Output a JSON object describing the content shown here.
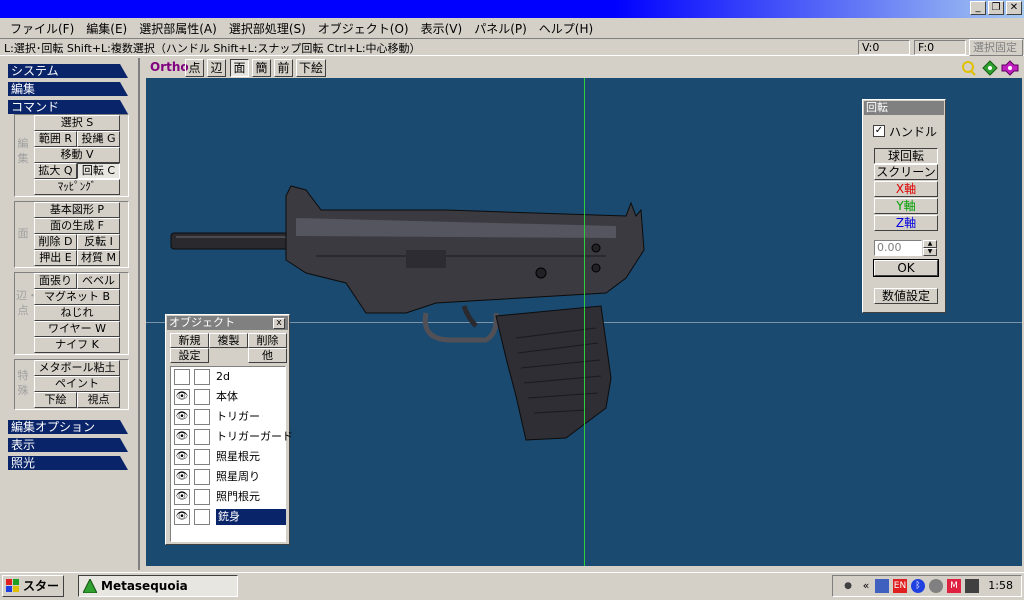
{
  "window": {
    "minimize_glyph": "_",
    "restore_glyph": "❐",
    "close_glyph": "✕"
  },
  "menu": [
    "ファイル(F)",
    "編集(E)",
    "選択部属性(A)",
    "選択部処理(S)",
    "オブジェクト(O)",
    "表示(V)",
    "パネル(P)",
    "ヘルプ(H)"
  ],
  "status": {
    "hint": "L:選択･回転  Shift+L:複数選択（ハンドル  Shift+L:スナップ回転  Ctrl+L:中心移動）",
    "v_value": "V:0",
    "f_value": "F:0",
    "lock_selection": "選択固定"
  },
  "left_panel": {
    "system": "システム",
    "edit": "編集",
    "command": "コマンド",
    "group_edit_label": "編集",
    "group_face_label": "面",
    "group_edge_label": "辺・点",
    "group_special_label": "特殊",
    "select": "選択 S",
    "range": "範囲 R",
    "lasso": "投縄 G",
    "move": "移動 V",
    "scale": "拡大 Q",
    "rotate": "回転 C",
    "mapping": "ﾏｯﾋﾟﾝｸﾞ",
    "basic_shape": "基本図形 P",
    "face_gen": "面の生成 F",
    "delete": "削除 D",
    "reverse": "反転 I",
    "extrude": "押出 E",
    "material": "材質 M",
    "face_stretch": "面張り",
    "bevel": "ベベル",
    "magnet": "マグネット B",
    "twist": "ねじれ",
    "wire": "ワイヤー W",
    "knife": "ナイフ K",
    "metaball": "メタボール粘土",
    "paint": "ペイント",
    "underlay": "下絵",
    "viewpoint": "視点",
    "edit_option": "編集オプション",
    "display": "表示",
    "lighting": "照光"
  },
  "view_toolbar": {
    "ortho": "Ortho",
    "point": "点",
    "edge": "辺",
    "face": "面",
    "simple": "簡",
    "front": "前",
    "underlay": "下絵"
  },
  "rotate_panel": {
    "title": "回転",
    "handle_checked": true,
    "handle_label": "ハンドル",
    "sphere_rotate": "球回転",
    "screen": "スクリーン",
    "x_axis": "X軸",
    "y_axis": "Y軸",
    "z_axis": "Z軸",
    "angle_value": "0.00",
    "ok": "OK",
    "numeric": "数値設定"
  },
  "object_panel": {
    "title": "オブジェクト",
    "close": "x",
    "new": "新規",
    "copy": "複製",
    "delete": "削除",
    "settings": "設定",
    "other": "他",
    "items": [
      {
        "name": "2d",
        "visible": false,
        "selected": false
      },
      {
        "name": "本体",
        "visible": true,
        "selected": false
      },
      {
        "name": "トリガー",
        "visible": true,
        "selected": false
      },
      {
        "name": "トリガーガード",
        "visible": true,
        "selected": false
      },
      {
        "name": "照星根元",
        "visible": true,
        "selected": false
      },
      {
        "name": "照星周り",
        "visible": true,
        "selected": false
      },
      {
        "name": "照門根元",
        "visible": true,
        "selected": false
      },
      {
        "name": "銃身",
        "visible": true,
        "selected": true
      }
    ]
  },
  "taskbar": {
    "start": "スタート",
    "app": "Metasequoia",
    "clock": "1:58"
  }
}
